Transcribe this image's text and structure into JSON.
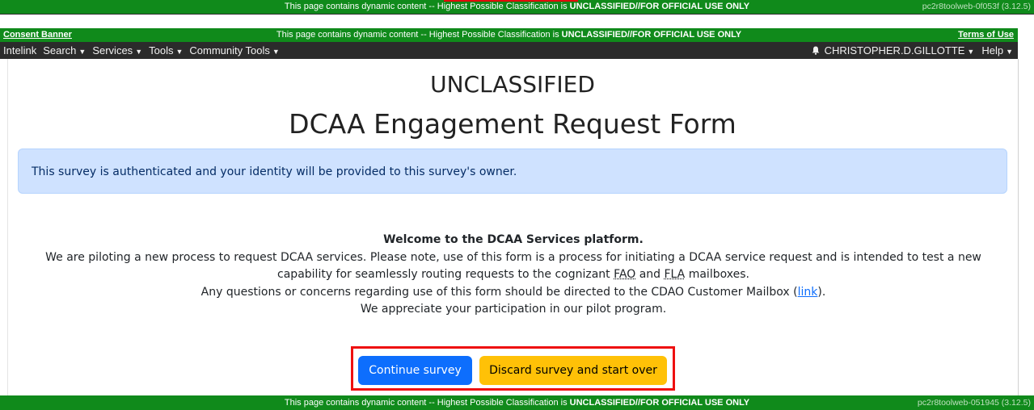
{
  "top_banner": {
    "prefix": "This page contains dynamic content -- Highest Possible Classification is ",
    "classification": "UNCLASSIFIED//FOR OFFICIAL USE ONLY",
    "host": "pc2r8toolweb-0f053f (3.12.5)"
  },
  "consent_bar": {
    "consent_link": "Consent Banner",
    "prefix": "This page contains dynamic content -- Highest Possible Classification is ",
    "classification": "UNCLASSIFIED//FOR OFFICIAL USE ONLY",
    "terms_link": "Terms of Use"
  },
  "navbar": {
    "brand": "Intelink",
    "menus": [
      "Search",
      "Services",
      "Tools",
      "Community Tools"
    ],
    "user": "CHRISTOPHER.D.GILLOTTE",
    "help": "Help",
    "icons": {
      "notification": "bell-icon",
      "dropdown": "caret-down-icon"
    }
  },
  "page": {
    "classification_heading": "UNCLASSIFIED",
    "title": "DCAA Engagement Request Form",
    "alert": "This survey is authenticated and your identity will be provided to this survey's owner.",
    "welcome": "Welcome to the DCAA Services platform.",
    "paragraph1_a": "We are piloting a new process to request DCAA services. Please note, use of this form is a process for initiating a DCAA service request and is intended to test a new",
    "paragraph1_b": "capability for seamlessly routing requests to the cognizant ",
    "abbr_fao": "FAO",
    "paragraph1_and": " and ",
    "abbr_fla": "FLA",
    "paragraph1_end": " mailboxes.",
    "paragraph2_a": "Any questions or concerns regarding use of this form should be directed to the CDAO Customer Mailbox (",
    "paragraph2_link": "link",
    "paragraph2_end": ").",
    "paragraph3": "We appreciate your participation in our pilot program."
  },
  "buttons": {
    "continue": "Continue survey",
    "discard": "Discard survey and start over"
  },
  "bottom_banner": {
    "prefix": "This page contains dynamic content -- Highest Possible Classification is ",
    "classification": "UNCLASSIFIED//FOR OFFICIAL USE ONLY",
    "host": "pc2r8toolweb-051945 (3.12.5)"
  },
  "colors": {
    "banner_green": "#108a1b",
    "navbar": "#2b2b2b",
    "primary": "#0d6efd",
    "warning": "#ffc107",
    "highlight_red": "#ee1010",
    "alert_bg": "#cfe2ff"
  }
}
